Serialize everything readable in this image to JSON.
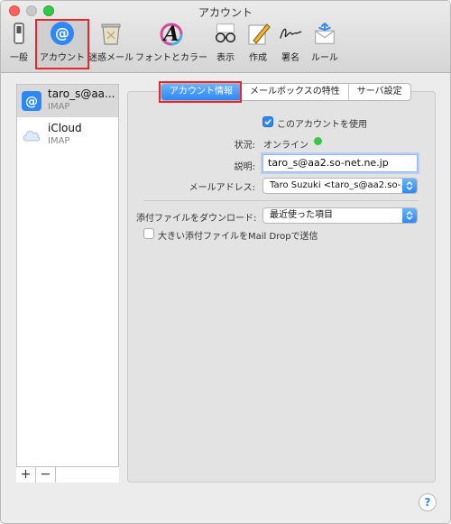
{
  "window": {
    "title": "アカウント"
  },
  "toolbar": {
    "items": [
      {
        "label": "一般",
        "icon": "switch-icon"
      },
      {
        "label": "アカウント",
        "icon": "at-sign-icon",
        "selected": true
      },
      {
        "label": "迷惑メール",
        "icon": "trash-bin-icon"
      },
      {
        "label": "フォントとカラー",
        "icon": "font-color-icon"
      },
      {
        "label": "表示",
        "icon": "glasses-icon"
      },
      {
        "label": "作成",
        "icon": "pencil-paper-icon"
      },
      {
        "label": "署名",
        "icon": "signature-icon"
      },
      {
        "label": "ルール",
        "icon": "rules-envelope-icon"
      }
    ]
  },
  "sidebar": {
    "accounts": [
      {
        "name": "taro_s@aa...",
        "type": "IMAP",
        "icon": "at-sign-icon"
      },
      {
        "name": "iCloud",
        "type": "IMAP",
        "icon": "cloud-icon"
      }
    ],
    "add_label": "+",
    "remove_label": "−"
  },
  "tabs": [
    {
      "label": "アカウント情報",
      "active": true
    },
    {
      "label": "メールボックスの特性"
    },
    {
      "label": "サーバ設定"
    }
  ],
  "form": {
    "enable_label": "このアカウントを使用",
    "enable_checked": true,
    "status_label": "状況:",
    "status_value": "オンライン",
    "description_label": "説明:",
    "description_value": "taro_s@aa2.so-net.ne.jp",
    "email_label": "メールアドレス:",
    "email_value": "Taro Suzuki <taro_s@aa2.so-...",
    "download_label": "添付ファイルをダウンロード:",
    "download_value": "最近使った項目",
    "maildrop_label": "大きい添付ファイルをMail Dropで送信",
    "maildrop_checked": false
  },
  "help": {
    "label": "?"
  },
  "colors": {
    "accent": "#2d87f4",
    "highlight_red": "#e8262b",
    "online_green": "#3ac44a"
  }
}
